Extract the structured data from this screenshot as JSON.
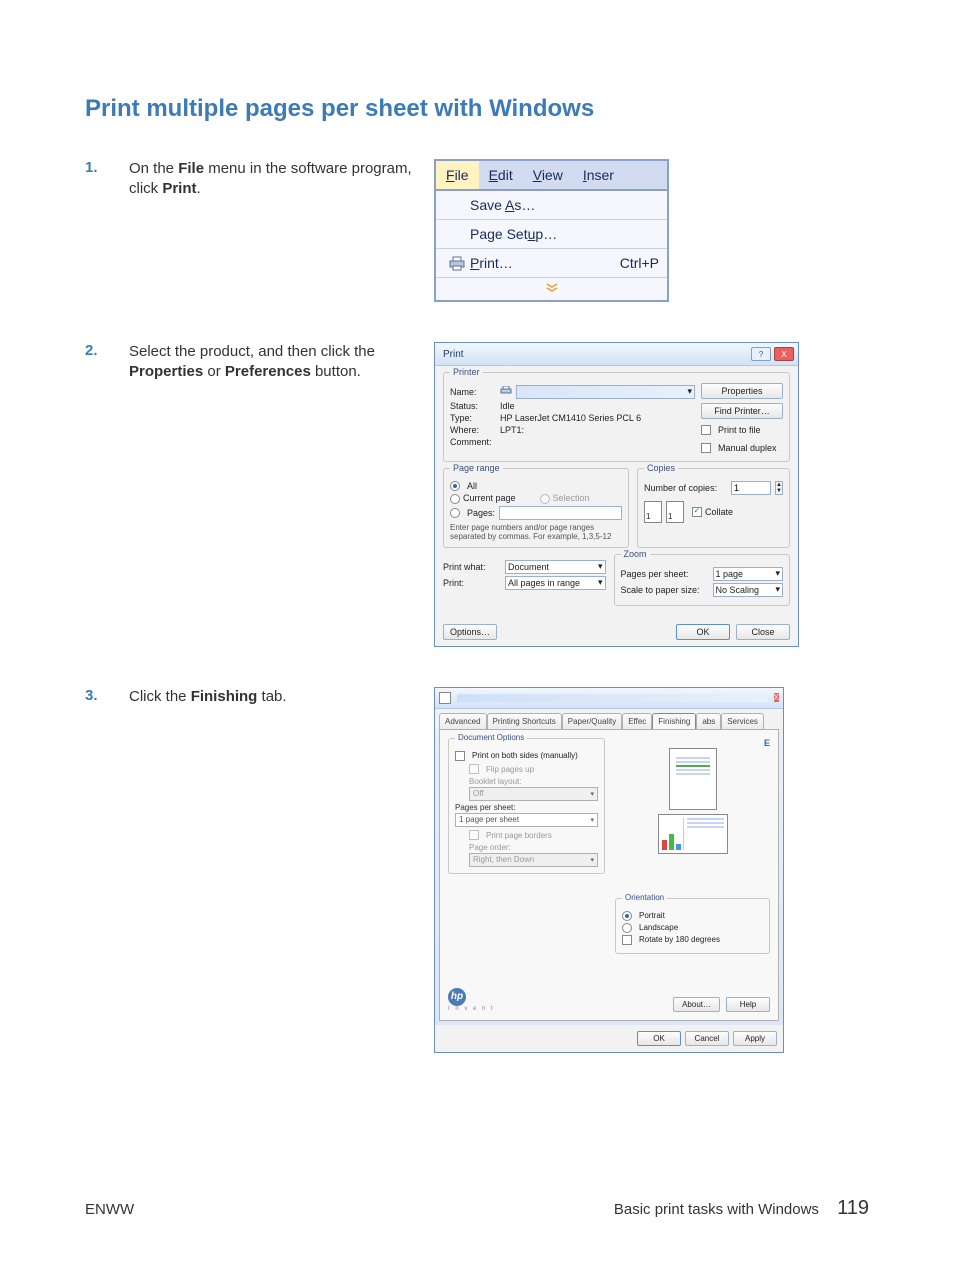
{
  "title": "Print multiple pages per sheet with Windows",
  "steps": {
    "s1": {
      "num": "1.",
      "text_pre": "On the ",
      "bold1": "File",
      "text_mid": " menu in the software program, click ",
      "bold2": "Print",
      "text_post": "."
    },
    "s2": {
      "num": "2.",
      "text_pre": "Select the product, and then click the ",
      "bold1": "Properties",
      "text_mid": " or ",
      "bold2": "Preferences",
      "text_post": " button."
    },
    "s3": {
      "num": "3.",
      "text_pre": "Click the ",
      "bold1": "Finishing",
      "text_post": " tab."
    }
  },
  "fig1": {
    "menu_file": "File",
    "menu_edit": "Edit",
    "menu_view": "View",
    "menu_inser": "Inser",
    "save_as": "Save As…",
    "page_setup": "Page Setup…",
    "print": "Print…",
    "print_shortcut": "Ctrl+P",
    "expand": "▾"
  },
  "fig2": {
    "title": "Print",
    "printer_legend": "Printer",
    "name_label": "Name:",
    "name_value": "",
    "status_label": "Status:",
    "status_value": "Idle",
    "type_label": "Type:",
    "type_value": "HP LaserJet CM1410 Series PCL 6",
    "where_label": "Where:",
    "where_value": "LPT1:",
    "comment_label": "Comment:",
    "comment_value": "",
    "properties_btn": "Properties",
    "find_printer_btn": "Find Printer…",
    "print_to_file": "Print to file",
    "manual_duplex": "Manual duplex",
    "pagerange_legend": "Page range",
    "all": "All",
    "current_page": "Current page",
    "selection": "Selection",
    "pages": "Pages:",
    "pagerange_hint": "Enter page numbers and/or page ranges separated by commas. For example, 1,3,5-12",
    "copies_legend": "Copies",
    "num_copies_label": "Number of copies:",
    "num_copies_value": "1",
    "collate": "Collate",
    "print_what_label": "Print what:",
    "print_what_value": "Document",
    "print_label": "Print:",
    "print_value": "All pages in range",
    "zoom_legend": "Zoom",
    "pps_label": "Pages per sheet:",
    "pps_value": "1 page",
    "scale_label": "Scale to paper size:",
    "scale_value": "No Scaling",
    "options_btn": "Options…",
    "ok_btn": "OK",
    "close_btn": "Close"
  },
  "fig3": {
    "tabs": {
      "t0": "Advanced",
      "t1": "Printing Shortcuts",
      "t2": "Paper/Quality",
      "t3": "Effec",
      "t4": "Finishing",
      "t5": "abs",
      "t6": "Services"
    },
    "doc_options_legend": "Document Options",
    "print_both_sides": "Print on both sides (manually)",
    "flip_pages_up": "Flip pages up",
    "booklet_label": "Booklet layout:",
    "booklet_value": "Off",
    "pps_label": "Pages per sheet:",
    "pps_value": "1 page per sheet",
    "print_page_borders": "Print page borders",
    "page_order_label": "Page order:",
    "page_order_value": "Right, then Down",
    "orientation_legend": "Orientation",
    "portrait": "Portrait",
    "landscape": "Landscape",
    "rotate": "Rotate by 180 degrees",
    "about_btn": "About…",
    "help_btn": "Help",
    "ok_btn": "OK",
    "cancel_btn": "Cancel",
    "apply_btn": "Apply"
  },
  "footer": {
    "left": "ENWW",
    "right_text": "Basic print tasks with Windows",
    "page_number": "119"
  }
}
